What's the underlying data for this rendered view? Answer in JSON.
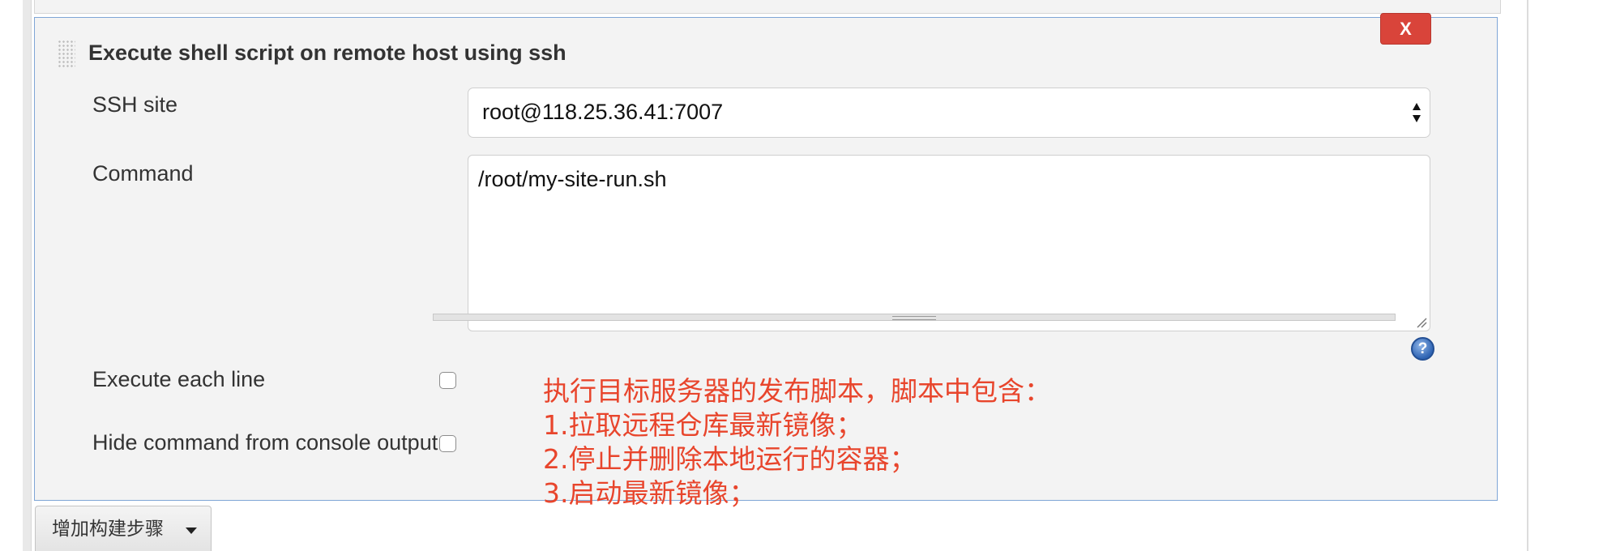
{
  "build_step": {
    "title": "Execute shell script on remote host using ssh",
    "delete_label": "X",
    "ssh_site": {
      "label": "SSH site",
      "selected": "root@118.25.36.41:7007"
    },
    "command": {
      "label": "Command",
      "value": "/root/my-site-run.sh"
    },
    "execute_each_line": {
      "label": "Execute each line",
      "checked": false
    },
    "hide_command": {
      "label": "Hide command from console output",
      "checked": false
    },
    "help_glyph": "?"
  },
  "annotation": {
    "lines": [
      "执行目标服务器的发布脚本，脚本中包含：",
      "1.拉取远程仓库最新镜像；",
      "2.停止并删除本地运行的容器；",
      "3.启动最新镜像；"
    ],
    "color": "#e8452c"
  },
  "add_build_step": {
    "label": "增加构建步骤"
  },
  "icons": {
    "drag": "drag-handle-icon",
    "select": "select-arrows-icon",
    "help": "help-icon",
    "caret": "caret-down-icon"
  },
  "colors": {
    "panel_border": "#7fa6d6",
    "delete_button": "#d9443a",
    "help_icon": "#2f64b3"
  }
}
